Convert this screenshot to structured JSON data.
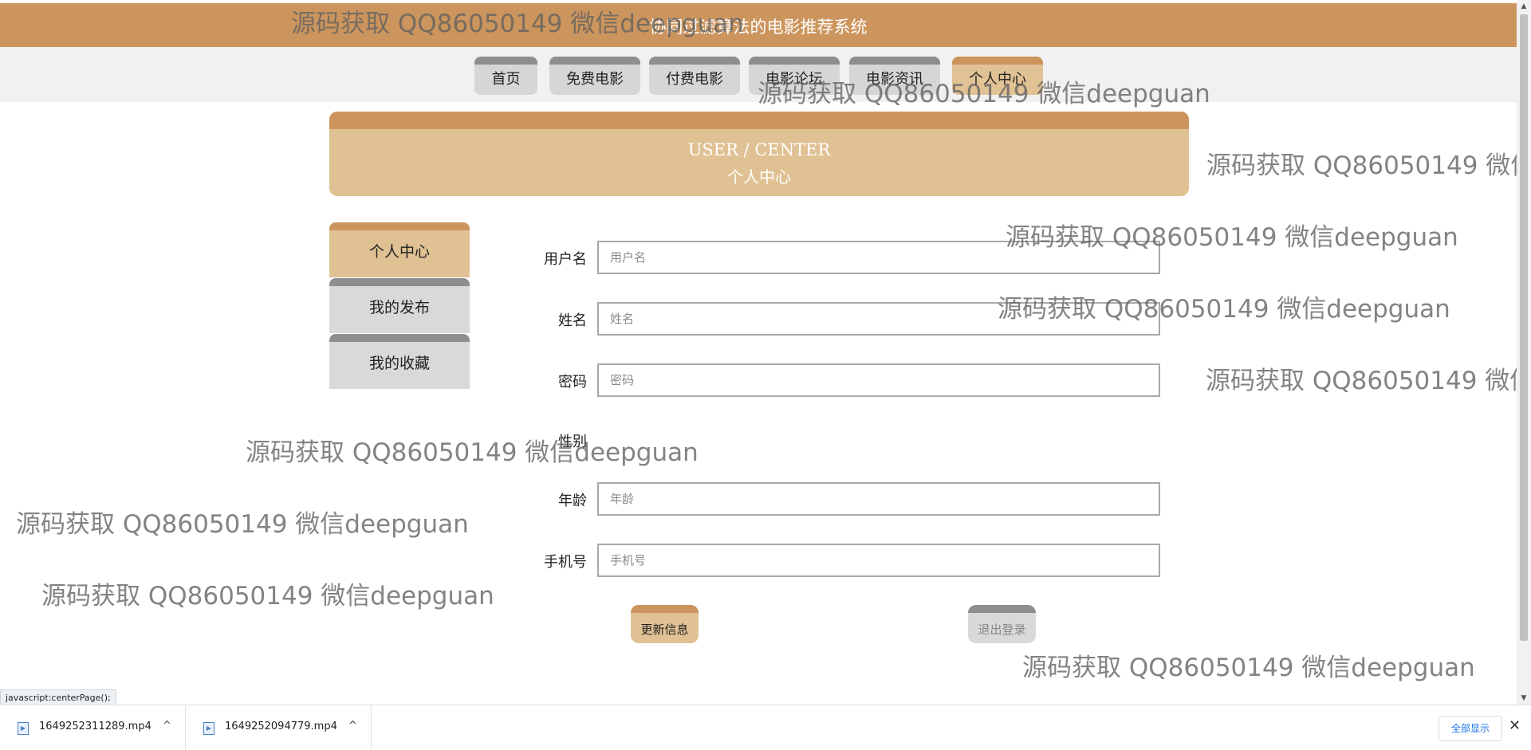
{
  "site": {
    "title": "协同过滤算法的电影推荐系统"
  },
  "nav": {
    "items": [
      {
        "label": "首页"
      },
      {
        "label": "免费电影"
      },
      {
        "label": "付费电影"
      },
      {
        "label": "电影论坛"
      },
      {
        "label": "电影资讯"
      },
      {
        "label": "个人中心",
        "active": true
      }
    ]
  },
  "banner": {
    "en": "USER / CENTER",
    "zh": "个人中心"
  },
  "side_menu": {
    "items": [
      {
        "label": "个人中心",
        "active": true
      },
      {
        "label": "我的发布"
      },
      {
        "label": "我的收藏"
      }
    ]
  },
  "form": {
    "username": {
      "label": "用户名",
      "placeholder": "用户名",
      "value": ""
    },
    "name": {
      "label": "姓名",
      "placeholder": "姓名",
      "value": ""
    },
    "password": {
      "label": "密码",
      "placeholder": "密码",
      "value": ""
    },
    "gender": {
      "label": "性别"
    },
    "age": {
      "label": "年龄",
      "placeholder": "年龄",
      "value": ""
    },
    "phone": {
      "label": "手机号",
      "placeholder": "手机号",
      "value": ""
    },
    "update_label": "更新信息",
    "logout_label": "退出登录"
  },
  "watermark": {
    "text": "源码获取 QQ86050149 微信deepguan"
  },
  "status_bar": {
    "text": "javascript:centerPage();"
  },
  "downloads": {
    "items": [
      {
        "name": "1649252311289.mp4"
      },
      {
        "name": "1649252094779.mp4"
      }
    ],
    "show_all_label": "全部显示"
  },
  "colors": {
    "accent": "#cc955d",
    "accent_light": "#e0c193",
    "inactive": "#d9d9d9",
    "inactive_top": "#8e8e8e"
  }
}
